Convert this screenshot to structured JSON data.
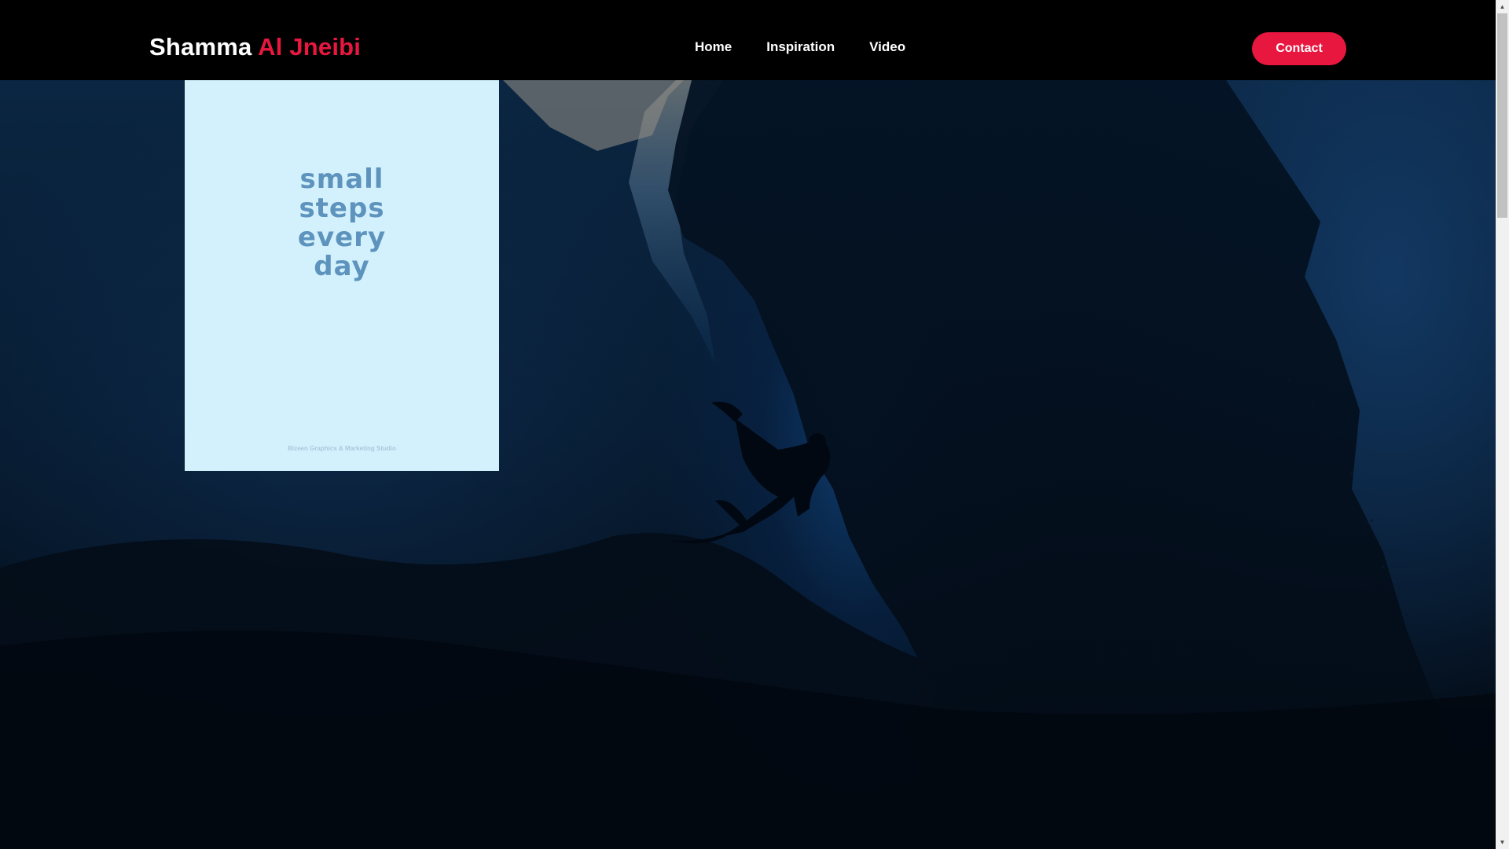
{
  "header": {
    "logo_first": "Shamma",
    "logo_last": "Al Jneibi",
    "nav": [
      "Home",
      "Inspiration",
      "Video"
    ],
    "contact_label": "Contact"
  },
  "poster": {
    "quote_lines": [
      "small",
      "steps",
      "every",
      "day"
    ],
    "credit": "Bizeen Graphics & Marketing Studio"
  },
  "colors": {
    "accent": "#e8173f",
    "header_bg": "#000000",
    "poster_bg": "#d3f1fd",
    "poster_text": "#5d93bd"
  },
  "icons": {
    "scroll_up": "triangle-up-icon",
    "scroll_down": "triangle-down-icon"
  }
}
